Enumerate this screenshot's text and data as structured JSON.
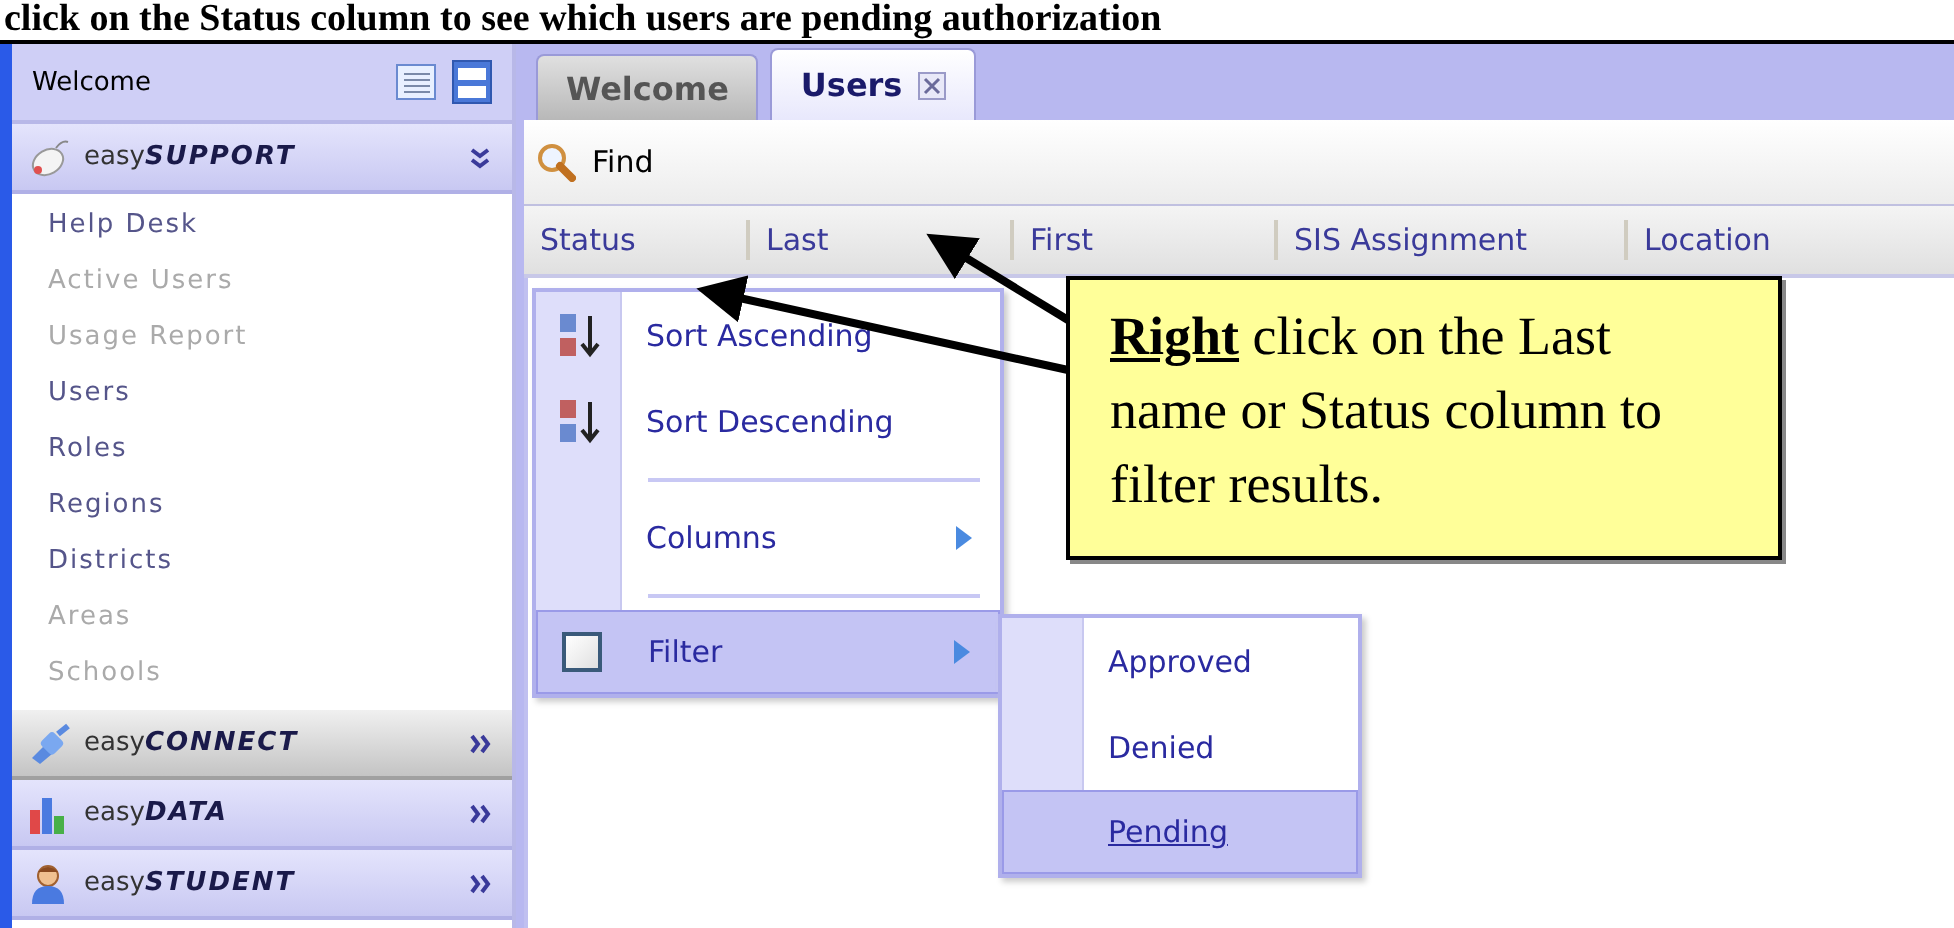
{
  "caption": "click on the Status column to see which users are pending authorization",
  "sidebar": {
    "title": "Welcome",
    "sections": [
      {
        "prefix": "easy",
        "name": "**SUPPORT**",
        "expanded": true,
        "highlighted": false,
        "items": [
          {
            "label": "Help Desk",
            "disabled": false
          },
          {
            "label": "Active Users",
            "disabled": true
          },
          {
            "label": "Usage Report",
            "disabled": true
          },
          {
            "label": "Users",
            "disabled": false
          },
          {
            "label": "Roles",
            "disabled": false
          },
          {
            "label": "Regions",
            "disabled": false
          },
          {
            "label": "Districts",
            "disabled": false
          },
          {
            "label": "Areas",
            "disabled": true
          },
          {
            "label": "Schools",
            "disabled": true
          }
        ]
      },
      {
        "prefix": "easy",
        "name": "**CONNECT**",
        "expanded": false,
        "highlighted": true
      },
      {
        "prefix": "easy",
        "name": "**DATA**",
        "expanded": false,
        "highlighted": false
      },
      {
        "prefix": "easy",
        "name": "**STUDENT**",
        "expanded": false,
        "highlighted": false
      }
    ]
  },
  "tabs": [
    {
      "label": "Welcome",
      "selected": false,
      "closable": false
    },
    {
      "label": "Users",
      "selected": true,
      "closable": true
    }
  ],
  "toolbar": {
    "find": "Find"
  },
  "columns": [
    "Status",
    "Last",
    "First",
    "SIS Assignment",
    "Location"
  ],
  "context_menu": [
    {
      "kind": "sort-ascending",
      "label": "Sort Ascending",
      "selected": false
    },
    {
      "kind": "sort-descending",
      "label": "Sort Descending",
      "selected": false
    },
    {
      "kind": "separator"
    },
    {
      "kind": "submenu",
      "label": "Columns",
      "selected": false
    },
    {
      "kind": "separator"
    },
    {
      "kind": "check-submenu",
      "label": "Filter",
      "checked": false,
      "selected": true
    }
  ],
  "submenu": [
    {
      "label": "Approved",
      "selected": false
    },
    {
      "label": "Denied",
      "selected": false
    },
    {
      "label": "Pending",
      "selected": true
    }
  ],
  "callout": {
    "text": "**Right** click on the Last name or Status column to filter results."
  }
}
